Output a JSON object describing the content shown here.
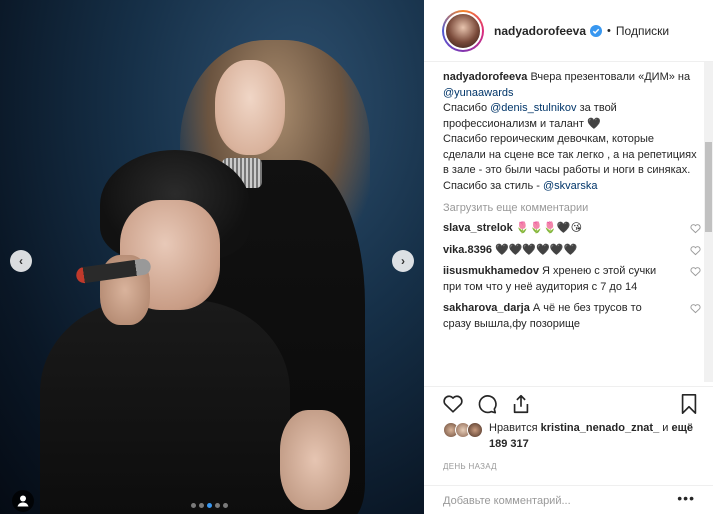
{
  "post": {
    "author": "nadyadorofeeva",
    "follow_label": "Подписки",
    "separator": "•",
    "caption": {
      "user": "nadyadorofeeva",
      "lines": [
        "Вчера презентовали «ДИМ» на ",
        "@yunaawards",
        "Спасибо ",
        "@denis_stulnikov",
        " за твой профессионализм и талант 🖤",
        "Спасибо героическим девочкам, которые сделали на сцене все так легко , а на репетициях в зале - это были часы работы и ноги в синяках.",
        "Спасибо за стиль - ",
        "@skvarska"
      ]
    },
    "load_more": "Загрузить еще комментарии",
    "comments": [
      {
        "user": "slava_strelok",
        "text": "🌷🌷🌷🖤😘"
      },
      {
        "user": "vika.8396",
        "text": "🖤🖤🖤🖤🖤🖤"
      },
      {
        "user": "iisusmukhamedov",
        "text": "Я хренею с этой сучки при том что у неё аудитория с 7 до 14"
      },
      {
        "user": "sakharova_darja",
        "text": "А чё не без трусов то сразу вышла,фу позорище"
      }
    ],
    "likes": {
      "prefix": "Нравится ",
      "user": "kristina_nenado_znat_",
      "middle": " и ",
      "count": "ещё 189 317"
    },
    "time": "ДЕНЬ НАЗАД",
    "comment_placeholder": "Добавьте комментарий...",
    "more": "•••"
  },
  "carousel": {
    "prev": "‹",
    "next": "›",
    "dots_total": 5,
    "active_dot": 2
  },
  "colors": {
    "link": "#003569",
    "verified": "#3897f0",
    "muted": "#999999"
  }
}
